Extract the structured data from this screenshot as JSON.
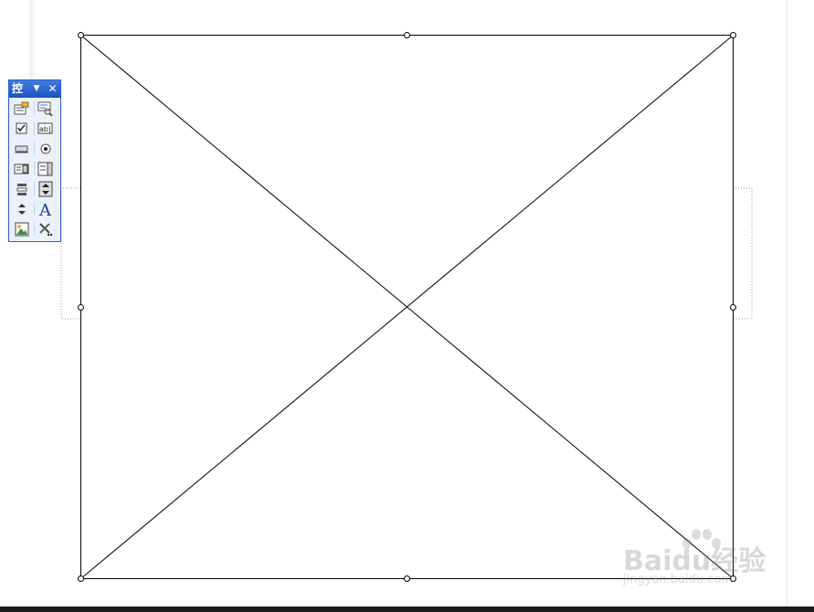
{
  "toolbox": {
    "title": "控",
    "dropdown_glyph": "▼",
    "close_glyph": "✕",
    "tools": [
      [
        "properties-icon",
        "view-code-icon"
      ],
      [
        "checkbox-icon",
        "textbox-icon"
      ],
      [
        "command-button-icon",
        "option-button-icon"
      ],
      [
        "listbox-icon",
        "combobox-icon"
      ],
      [
        "scrollbar-icon",
        "spin-button-icon"
      ],
      [
        "spin-small-icon",
        "label-icon"
      ],
      [
        "image-icon",
        "more-controls-icon"
      ]
    ],
    "label_glyph": "A",
    "textbox_glyph": "ab|"
  },
  "watermark": {
    "brand": "Baidu经验",
    "url": "jingyan.baidu.com"
  },
  "colors": {
    "toolbox_border": "#2b5ccf",
    "toolbox_title": "#1c52c4",
    "shape_stroke": "#000000"
  }
}
